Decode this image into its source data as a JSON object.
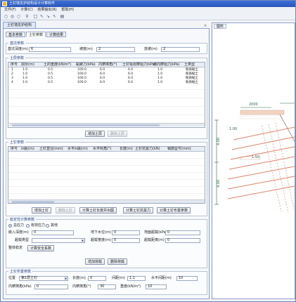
{
  "window": {
    "title": "土钉墙支护结构设计计算软件"
  },
  "menu": [
    "文件(F)",
    "计算(C)",
    "结果输出(R)",
    "帮助(H)"
  ],
  "toolbar_icons": [
    "new-icon",
    "open-icon",
    "save-icon",
    "run-icon",
    "zoom-in-icon",
    "zoom-out-icon",
    "pan-icon",
    "fit-icon",
    "print-icon"
  ],
  "doc_tab": {
    "label": "土钉墙支护结构",
    "close": "×"
  },
  "subtabs": [
    "基本参数",
    "土钉参数",
    "计算结果"
  ],
  "top_group": {
    "title": "基坑参数",
    "fields": [
      {
        "label": "基坑深度(m)",
        "value": "6"
      },
      {
        "label": "坡度(m)",
        "value": "2"
      },
      {
        "label": "放坡(m)",
        "value": "2"
      }
    ]
  },
  "soil_group": {
    "title": "土层参数",
    "columns": [
      "序号",
      "层厚(m)",
      "土的重度(kN/m³)",
      "黏聚力(kPa)",
      "内摩擦角(°)",
      "土钉极限摩阻力(kPa)",
      "侧向摩阻力(kPa)",
      "土类型"
    ],
    "rows": [
      [
        "1",
        "1.0",
        "0.5",
        "100.0",
        "6.0",
        "6.0",
        "1.0",
        "粉质黏土"
      ],
      [
        "2",
        "1.0",
        "0.5",
        "100.0",
        "6.0",
        "6.0",
        "1.0",
        "粉质黏土"
      ],
      [
        "3",
        "1.0",
        "0.5",
        "100.0",
        "6.0",
        "6.0",
        "1.0",
        "粉质黏土"
      ],
      [
        "4",
        "1.0",
        "0.5",
        "100.0",
        "6.0",
        "6.0",
        "1.0",
        "粉质黏土"
      ]
    ],
    "buttons": {
      "add": "增加土层",
      "delete": "删除土层"
    }
  },
  "nail_group": {
    "title": "土钉参数",
    "columns": [
      "序号",
      "间距(m)",
      "土钉直径(mm)",
      "水平间距(m)",
      "水平倾角(°)",
      "长度(m)",
      "土钉抗拔力(kN)",
      "钢筋型号(mm)"
    ],
    "buttons": [
      "增加土钉",
      "删除土钉",
      "计算土钉长度并出图",
      "计算土钉抗拔力",
      "计算土钉布置参数"
    ]
  },
  "stability_group": {
    "title": "稳定性计算参数",
    "radios": [
      {
        "label": "总应力",
        "on": true
      },
      {
        "label": "有效应力",
        "on": false
      },
      {
        "label": "其他",
        "on": false
      }
    ],
    "rows": [
      [
        {
          "label": "嵌入深度(m)",
          "value": "0"
        },
        {
          "label": "地下水位(m)",
          "value": "0"
        },
        {
          "label": "地面超载(kPa)",
          "value": "0"
        }
      ],
      [
        {
          "label": "超载类型",
          "value": ""
        },
        {
          "label": "超载宽度(m)",
          "value": "0"
        },
        {
          "label": "超载距离(m)",
          "value": "0"
        }
      ]
    ],
    "calc_row": {
      "label": "整体稳定",
      "button": "计算安全系数"
    },
    "buttons": [
      "增加荷载",
      "删除荷载"
    ]
  },
  "bottom_group": {
    "title": "土钉布置参数",
    "fields": [
      {
        "label": "位置",
        "value": "第1层土钉"
      },
      {
        "label": "长度(m)",
        "value": "0"
      },
      {
        "label": "间距(m)",
        "value": "1.1"
      },
      {
        "label": "水平间距(m)",
        "value": "10"
      },
      {
        "label": "内摩擦角(kPa)",
        "value": "0"
      },
      {
        "label": "内摩擦角(°)",
        "value": "30"
      },
      {
        "label": "重度(kN/m³)",
        "value": "10"
      }
    ]
  },
  "right_view": {
    "tab": "图形",
    "dims": [
      "2000",
      "1.00",
      "1.50",
      "4.00",
      "4.00"
    ]
  },
  "colors": {
    "nail": "#e0826a",
    "soil_fill": "#f3d3c4",
    "dim": "#2a6a4a",
    "accent": "#2a55b8"
  }
}
